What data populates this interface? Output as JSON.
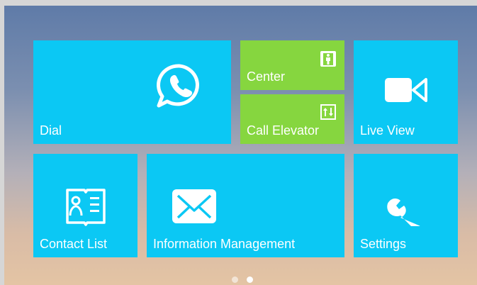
{
  "tiles": {
    "dial": {
      "label": "Dial",
      "icon": "phone-chat-icon"
    },
    "center": {
      "label": "Center",
      "icon": "elevator-person-icon"
    },
    "call_elevator": {
      "label": "Call Elevator",
      "icon": "elevator-arrows-icon"
    },
    "live_view": {
      "label": "Live View",
      "icon": "video-camera-icon"
    },
    "contact_list": {
      "label": "Contact List",
      "icon": "contact-book-icon"
    },
    "information_management": {
      "label": "Information Management",
      "icon": "envelope-icon"
    },
    "settings": {
      "label": "Settings",
      "icon": "wrench-icon"
    }
  },
  "pagination": {
    "pages": 2,
    "active": 2
  },
  "colors": {
    "tile_blue": "#0bc8f4",
    "tile_green": "#86d63f",
    "label": "#ffffff"
  }
}
